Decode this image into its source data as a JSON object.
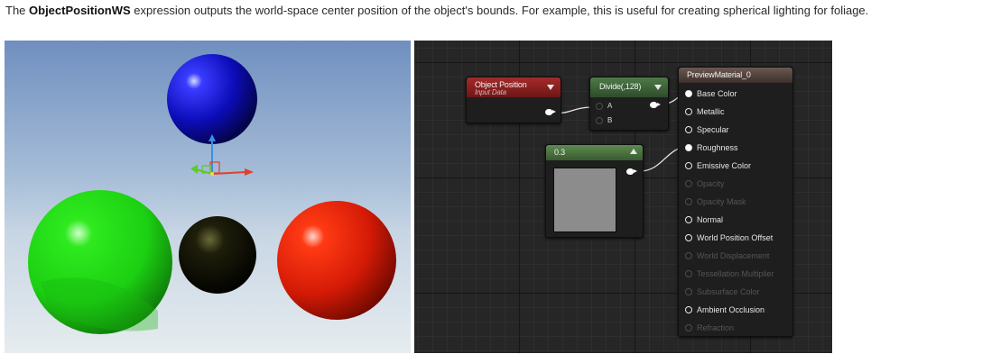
{
  "caption": {
    "prefix": "The ",
    "term": "ObjectPositionWS",
    "suffix": " expression outputs the world-space center position of the object's bounds. For example, this is useful for creating spherical lighting for foliage."
  },
  "graph": {
    "object_position": {
      "title": "Object Position",
      "subtitle": "Input Data"
    },
    "divide": {
      "title": "Divide(,128)",
      "input_a": "A",
      "input_b": "B"
    },
    "constant": {
      "value": "0.3"
    },
    "preview": {
      "title": "PreviewMaterial_0",
      "inputs": [
        {
          "label": "Base Color",
          "active": true,
          "connected": true
        },
        {
          "label": "Metallic",
          "active": true,
          "connected": false
        },
        {
          "label": "Specular",
          "active": true,
          "connected": false
        },
        {
          "label": "Roughness",
          "active": true,
          "connected": true
        },
        {
          "label": "Emissive Color",
          "active": true,
          "connected": false
        },
        {
          "label": "Opacity",
          "active": false,
          "connected": false
        },
        {
          "label": "Opacity Mask",
          "active": false,
          "connected": false
        },
        {
          "label": "Normal",
          "active": true,
          "connected": false
        },
        {
          "label": "World Position Offset",
          "active": true,
          "connected": false
        },
        {
          "label": "World Displacement",
          "active": false,
          "connected": false
        },
        {
          "label": "Tessellation Multiplier",
          "active": false,
          "connected": false
        },
        {
          "label": "Subsurface Color",
          "active": false,
          "connected": false
        },
        {
          "label": "Ambient Occlusion",
          "active": true,
          "connected": false
        },
        {
          "label": "Refraction",
          "active": false,
          "connected": false
        }
      ]
    }
  },
  "colors": {
    "object_position_header": "#8a1e1e",
    "divide_header": "#3f6b3a",
    "constant_header": "#4f7a42",
    "preview_header": "#5b4a45"
  }
}
